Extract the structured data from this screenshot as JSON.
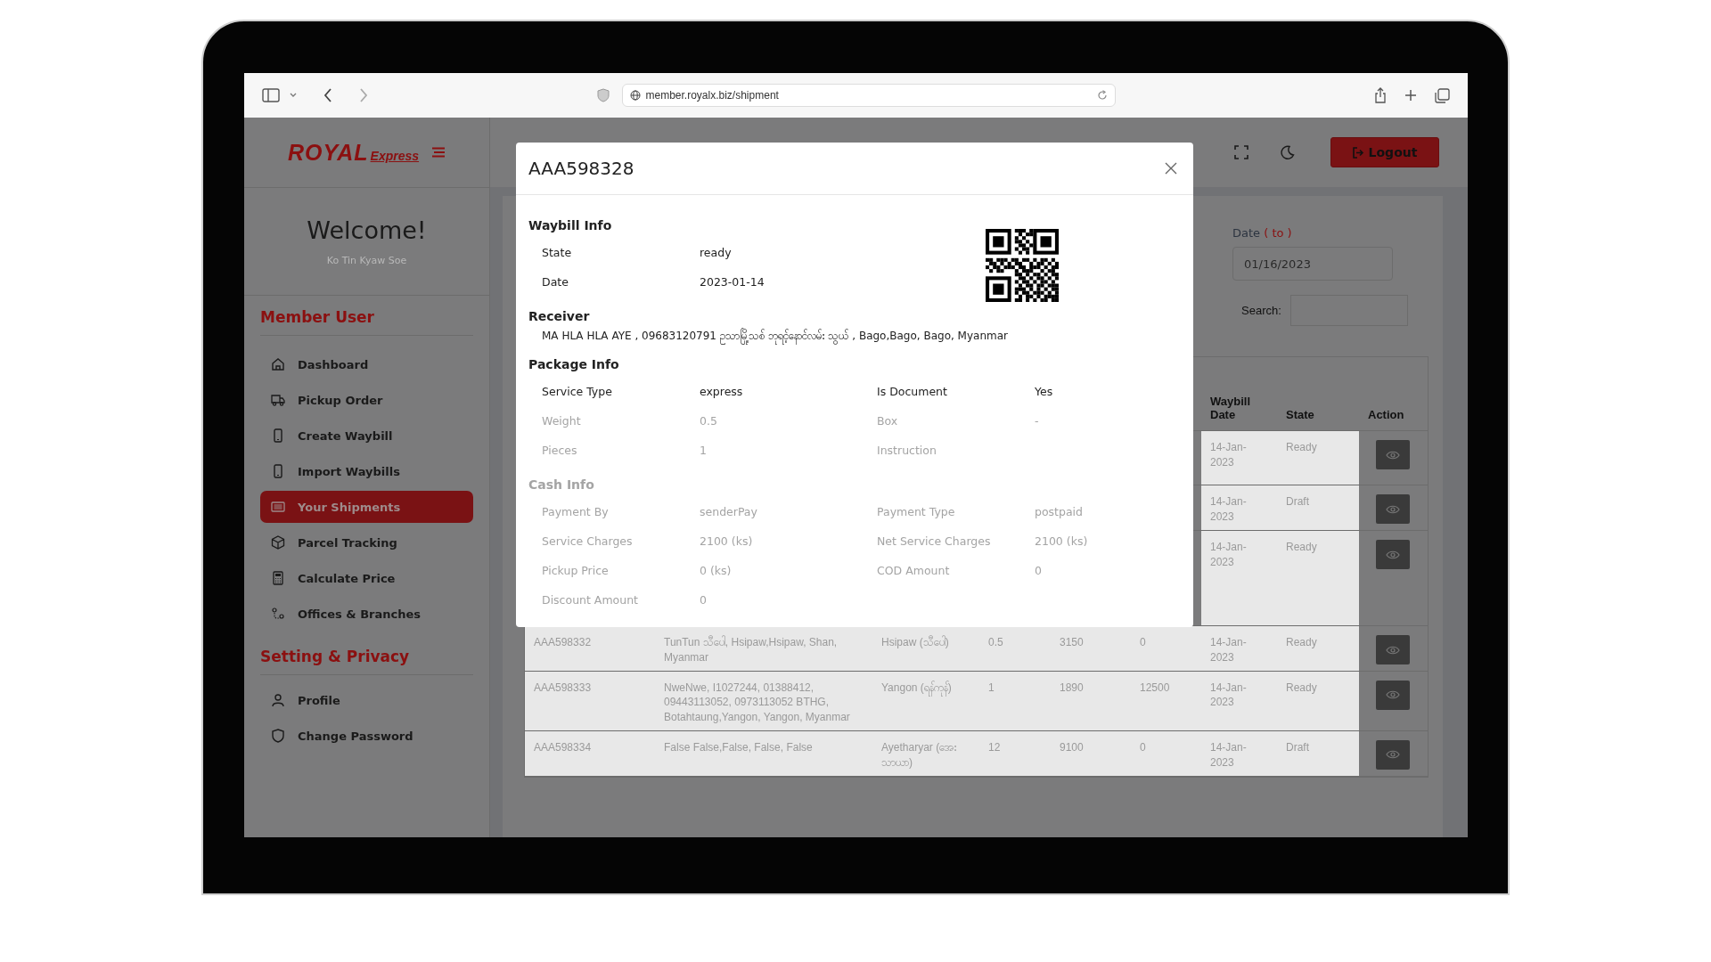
{
  "browser": {
    "url": "member.royalx.biz/shipment"
  },
  "brand": {
    "logo": "ROYAL",
    "logo_sub": "Express"
  },
  "welcome": {
    "title": "Welcome!",
    "user_name": "Ko Tin Kyaw Soe"
  },
  "sidebar": {
    "sections": [
      {
        "title": "Member User",
        "items": [
          {
            "label": "Dashboard",
            "selected": false
          },
          {
            "label": "Pickup Order",
            "selected": false
          },
          {
            "label": "Create Waybill",
            "selected": false
          },
          {
            "label": "Import Waybills",
            "selected": false
          },
          {
            "label": "Your Shipments",
            "selected": true
          },
          {
            "label": "Parcel Tracking",
            "selected": false
          },
          {
            "label": "Calculate Price",
            "selected": false
          },
          {
            "label": "Offices & Branches",
            "selected": false
          }
        ]
      },
      {
        "title": "Setting & Privacy",
        "items": [
          {
            "label": "Profile",
            "selected": false
          },
          {
            "label": "Change Password",
            "selected": false
          }
        ]
      }
    ]
  },
  "header": {
    "logout": "Logout"
  },
  "filters": {
    "date_label": "Date",
    "date_label_note": "( to )",
    "date_value": "01/16/2023",
    "search_label": "Search:"
  },
  "table": {
    "columns": [
      "Waybill Date",
      "State",
      "Action"
    ],
    "rows": [
      {
        "date": "14-Jan-2023",
        "state": "Ready"
      },
      {
        "date": "14-Jan-2023",
        "state": "Draft"
      },
      {
        "date": "14-Jan-2023",
        "state": "Ready"
      },
      {
        "waybill": "AAA598332",
        "receiver": "TunTun သီပေါ, Hsipaw,Hsipaw, Shan, Myanmar",
        "town": "Hsipaw (သီပေါ)",
        "weight": "0.5",
        "price": "3150",
        "cod": "0",
        "date": "14-Jan-2023",
        "state": "Ready"
      },
      {
        "waybill": "AAA598333",
        "receiver": "NweNwe, I1027244, 01388412, 09443113052, 0973113052 BTHG, Botahtaung,Yangon, Yangon, Myanmar",
        "town": "Yangon (ရန်ကုန်)",
        "weight": "1",
        "price": "1890",
        "cod": "12500",
        "date": "14-Jan-2023",
        "state": "Ready"
      },
      {
        "waybill": "AAA598334",
        "receiver": "False False,False, False, False",
        "town": "Ayetharyar (အေးသာယာ)",
        "weight": "12",
        "price": "9100",
        "cod": "0",
        "date": "14-Jan-2023",
        "state": "Draft"
      }
    ]
  },
  "modal": {
    "title": "AAA598328",
    "sections": [
      {
        "title": "Waybill Info",
        "faded": false,
        "rows": [
          {
            "faded": false,
            "fields": [
              {
                "label": "State",
                "value": "ready"
              }
            ]
          },
          {
            "faded": false,
            "fields": [
              {
                "label": "Date",
                "value": "2023-01-14"
              }
            ]
          }
        ]
      },
      {
        "title": "Receiver",
        "faded": false,
        "text": "MA HLA HLA AYE , 09683120791 ဥသာမြို့သစ် ဘုရင့်နောင်လမ်း သွယ် , Bago,Bago, Bago, Myanmar"
      },
      {
        "title": "Package Info",
        "faded": false,
        "rows": [
          {
            "faded": false,
            "fields": [
              {
                "label": "Service Type",
                "value": "express"
              },
              {
                "label": "Is Document",
                "value": "Yes"
              }
            ]
          },
          {
            "faded": true,
            "fields": [
              {
                "label": "Weight",
                "value": "0.5"
              },
              {
                "label": "Box",
                "value": "-"
              }
            ]
          },
          {
            "faded": true,
            "fields": [
              {
                "label": "Pieces",
                "value": "1"
              },
              {
                "label": "Instruction"
              }
            ]
          }
        ]
      },
      {
        "title": "Cash Info",
        "faded": true,
        "rows": [
          {
            "faded": true,
            "fields": [
              {
                "label": "Payment By",
                "value": "senderPay"
              },
              {
                "label": "Payment Type",
                "value": "postpaid"
              }
            ]
          },
          {
            "faded": true,
            "fields": [
              {
                "label": "Service Charges",
                "value": "2100 (ks)"
              },
              {
                "label": "Net Service Charges",
                "value": "2100 (ks)"
              }
            ]
          },
          {
            "faded": true,
            "fields": [
              {
                "label": "Pickup Price",
                "value": "0 (ks)"
              },
              {
                "label": "COD Amount",
                "value": "0"
              }
            ]
          },
          {
            "faded": true,
            "fields": [
              {
                "label": "Discount Amount",
                "value": "0"
              }
            ]
          }
        ]
      }
    ]
  }
}
